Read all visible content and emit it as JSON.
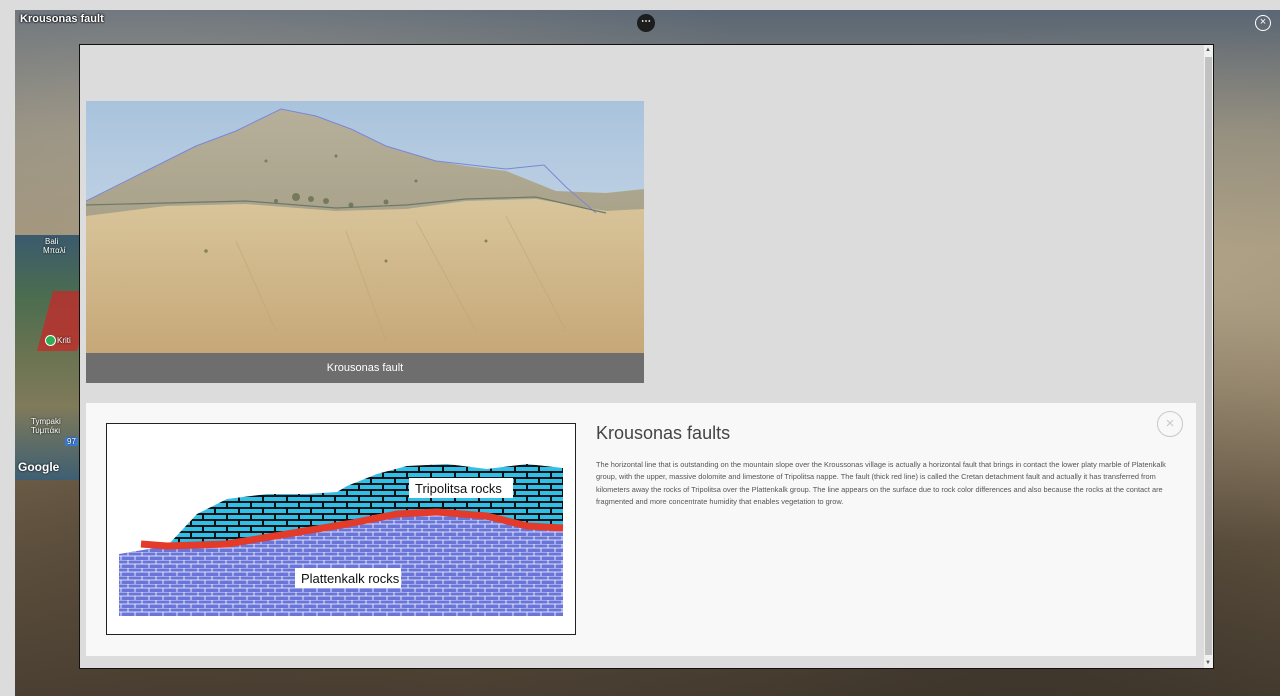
{
  "app": {
    "title": "Krousonas fault",
    "menu_glyph": "⋯",
    "close_glyph": "×"
  },
  "map": {
    "labels": [
      "Bali",
      "Μπαλί",
      "Kriti",
      "Tympaki",
      "Τυμπάκι"
    ],
    "google_logo": "Google",
    "route_badge": "97"
  },
  "photo": {
    "caption": "Krousonas fault"
  },
  "info": {
    "title": "Krousonas faults",
    "body": "The horizontal line that is outstanding on the mountain slope over the Kroussonas village is actually a horizontal fault that brings in contact the lower platy marble of Platenkalk group, with the upper, massive dolomite and limestone of Tripolitsa nappe. The fault (thick red line) is called the Cretan detachment fault and actually it has transferred from kilometers away the rocks of Tripolitsa over the Plattenkalk group. The line appears on the surface due to rock color differences and also because the rocks at the contact are fragmented and more concentrate humidity that enables vegetation to grow.",
    "close_glyph": "×"
  },
  "diagram": {
    "upper_label": "Tripolitsa rocks",
    "lower_label": "Plattenkalk rocks",
    "colors": {
      "upper": "#2ec0e8",
      "lower": "#6a75d9",
      "fault": "#e33a2a"
    }
  }
}
